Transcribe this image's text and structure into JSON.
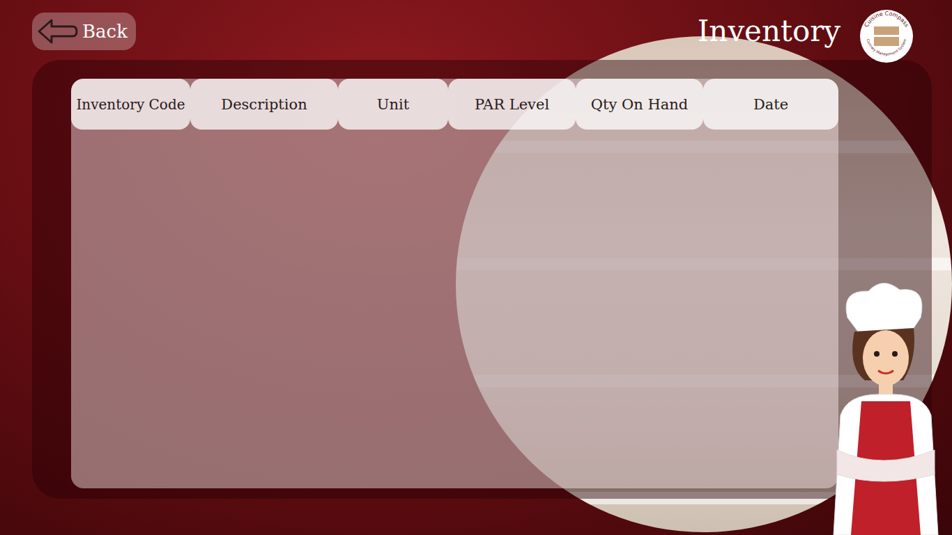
{
  "back_button": {
    "label": "Back"
  },
  "title": "Inventory",
  "logo": {
    "title": "Cuisine Compass",
    "subtitle": "Culinary Management System"
  },
  "table": {
    "columns": [
      "Inventory Code",
      "Description",
      "Unit",
      "PAR Level",
      "Qty On Hand",
      "Date"
    ],
    "rows": []
  }
}
